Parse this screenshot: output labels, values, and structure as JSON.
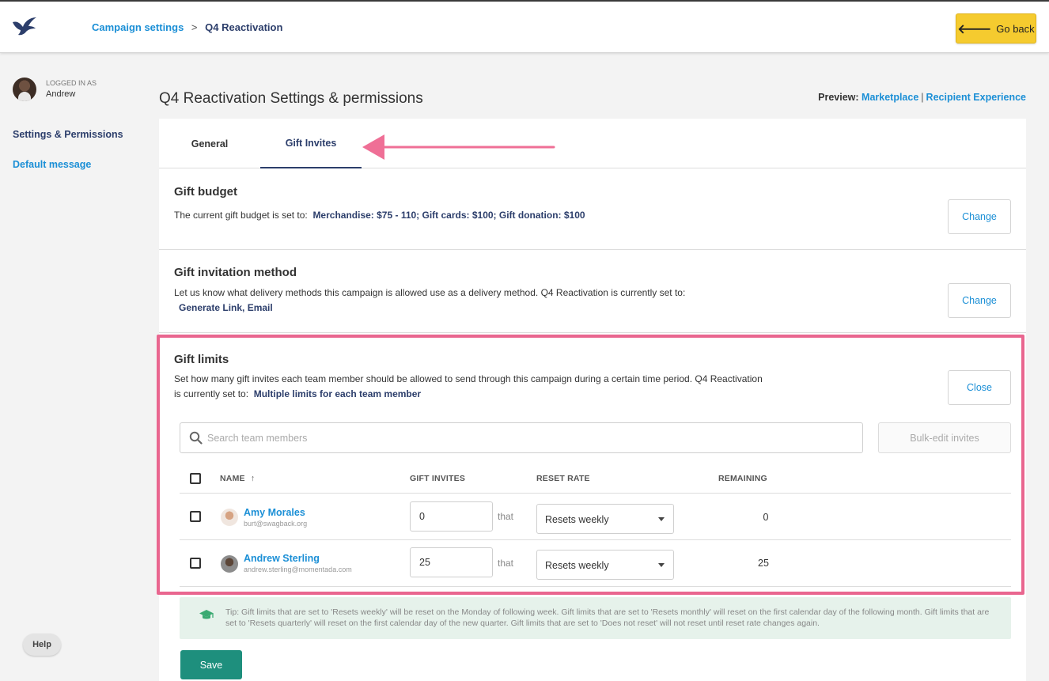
{
  "header": {
    "breadcrumb": {
      "link": "Campaign settings",
      "separator": ">",
      "current": "Q4 Reactivation"
    },
    "go_back_label": "Go back",
    "go_back_icon": "arrow-left-icon"
  },
  "sidebar": {
    "logged_in_label": "LOGGED IN AS",
    "user_name": "Andrew",
    "items": [
      {
        "label": "Settings & Permissions"
      },
      {
        "label": "Default message"
      }
    ],
    "help_label": "Help"
  },
  "main": {
    "page_title": "Q4 Reactivation Settings & permissions",
    "preview": {
      "label": "Preview:",
      "link1": "Marketplace",
      "pipe": "|",
      "link2": "Recipient Experience"
    },
    "tabs": [
      {
        "label": "General"
      },
      {
        "label": "Gift Invites"
      }
    ],
    "gift_budget": {
      "title": "Gift budget",
      "text": "The current gift budget is set to:",
      "value": "Merchandise: $75 - 110; Gift cards: $100; Gift donation: $100",
      "button": "Change"
    },
    "invitation_method": {
      "title": "Gift invitation method",
      "text": "Let us know what delivery methods this campaign is allowed use as a delivery method. Q4 Reactivation is currently set to:",
      "value": "Generate Link, Email",
      "button": "Change"
    },
    "gift_limits": {
      "title": "Gift limits",
      "text_line1": "Set how many gift invites each team member should be allowed to send through this campaign during a certain time period. Q4 Reactivation",
      "text_line2": "is currently set to:",
      "value": "Multiple limits for each team member",
      "button": "Close",
      "search_placeholder": "Search team members",
      "bulk_edit_label": "Bulk-edit invites",
      "columns": {
        "name": "NAME",
        "sort_indicator": "↑",
        "gift_invites": "GIFT INVITES",
        "reset_rate": "RESET RATE",
        "remaining": "REMAINING"
      },
      "rows": [
        {
          "name": "Amy Morales",
          "email": "burt@swagback.org",
          "invites": "0",
          "that": "that",
          "reset_rate": "Resets weekly",
          "remaining": "0"
        },
        {
          "name": "Andrew Sterling",
          "email": "andrew.sterling@momentada.com",
          "invites": "25",
          "that": "that",
          "reset_rate": "Resets weekly",
          "remaining": "25"
        }
      ],
      "tip": "Tip: Gift limits that are set to 'Resets weekly' will be reset on the Monday of following week. Gift limits that are set to 'Resets monthly' will reset on the first calendar day of the following month. Gift limits that are set to 'Resets quarterly' will reset on the first calendar day of the new quarter. Gift limits that are set to 'Does not reset' will not reset until reset rate changes again."
    },
    "save_label": "Save"
  },
  "colors": {
    "accent_link": "#1b8fd6",
    "navy": "#2c3e6b",
    "go_back_yellow": "#f5cb2f",
    "save_green": "#1e8f7d",
    "annotation_pink": "#e9668f",
    "tip_background": "#e6f2eb"
  }
}
